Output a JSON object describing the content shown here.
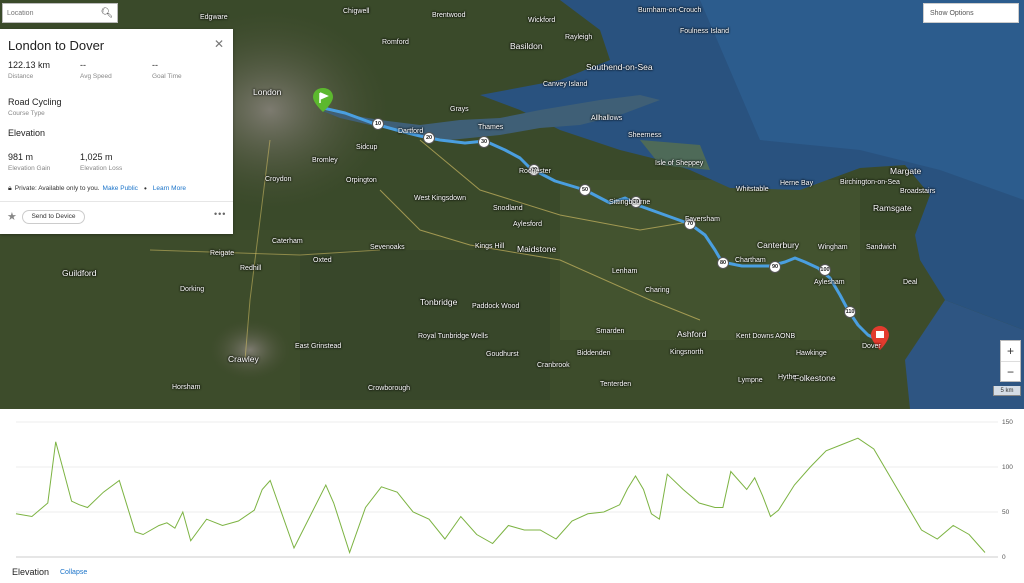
{
  "search": {
    "placeholder": "Location"
  },
  "options": {
    "label": "Show Options"
  },
  "panel": {
    "title": "London to Dover",
    "stats": [
      {
        "value": "122.13 km",
        "label": "Distance"
      },
      {
        "value": "--",
        "label": "Avg Speed"
      },
      {
        "value": "--",
        "label": "Goal Time"
      }
    ],
    "course_type": {
      "value": "Road Cycling",
      "label": "Course Type"
    },
    "elevation_heading": "Elevation",
    "elev_stats": [
      {
        "value": "981 m",
        "label": "Elevation Gain"
      },
      {
        "value": "1,025 m",
        "label": "Elevation Loss"
      }
    ],
    "privacy_text": "Private: Available only to you.",
    "make_public": "Make Public",
    "learn_more": "Learn More",
    "send_label": "Send to Device",
    "more_label": "•••"
  },
  "zoom": {
    "in": "+",
    "out": "−"
  },
  "scale": "5 km",
  "markers": [
    "10",
    "20",
    "30",
    "40",
    "50",
    "60",
    "70",
    "80",
    "90",
    "100",
    "110"
  ],
  "places": [
    "Edgware",
    "Romford",
    "Brentwood",
    "Basildon",
    "Wickford",
    "Southend-on-Sea",
    "Canvey Island",
    "London",
    "Grays",
    "Dartford",
    "Thames",
    "Bromley",
    "Sidcup",
    "Croydon",
    "Orpington",
    "West Kingsdown",
    "Snodland",
    "Aylesford",
    "Maidstone",
    "Kings Hill",
    "Sevenoaks",
    "Oxted",
    "Caterham",
    "Redhill",
    "Guildford",
    "Tonbridge",
    "Royal Tunbridge Wells",
    "East Grinstead",
    "Crawley",
    "Horsham",
    "Isle of Sheppey",
    "Sheerness",
    "Allhallows",
    "Whitstable",
    "Herne Bay",
    "Margate",
    "Ramsgate",
    "Canterbury",
    "Wingham",
    "Sandwich",
    "Deal",
    "Aylesham",
    "Chartham",
    "Faversham",
    "Sittingbourne",
    "Rochester",
    "Ashford",
    "Lenham",
    "Charing",
    "Hawkinge",
    "Folkestone",
    "Dover",
    "Broadstairs",
    "Birchington-on-Sea",
    "Foulness Island",
    "Burnham-on-Crouch",
    "Rayleigh",
    "Chigwell",
    "Cranbrook",
    "Biddenden",
    "Tenterden",
    "Goudhurst",
    "Crowborough",
    "Paddock Wood",
    "Smarden",
    "Kingsnorth",
    "Lympne",
    "Hythe",
    "Kent Downs AONB",
    "Dorking",
    "Reigate"
  ],
  "elevation": {
    "title": "Elevation",
    "collapse": "Collapse",
    "color": "#7cb342"
  },
  "route_color": "#4a9fe0",
  "chart_data": {
    "type": "area",
    "ylim": [
      0,
      150
    ],
    "yticks": [
      "150",
      "100",
      "50",
      "0"
    ],
    "x": [
      0,
      2,
      4,
      5,
      6,
      7,
      8,
      9,
      11,
      13,
      15,
      16,
      18,
      19,
      20,
      21,
      22,
      24,
      26,
      28,
      30,
      31,
      32,
      33,
      35,
      37,
      39,
      40,
      42,
      44,
      46,
      48,
      50,
      52,
      54,
      56,
      58,
      60,
      62,
      64,
      66,
      68,
      70,
      72,
      74,
      76,
      77,
      78,
      79,
      80,
      81,
      82,
      84,
      86,
      88,
      89,
      90,
      92,
      93,
      94,
      95,
      96,
      98,
      100,
      102,
      104,
      106,
      108,
      110,
      112,
      114,
      116,
      118,
      120,
      122
    ],
    "values": [
      48,
      45,
      60,
      128,
      95,
      62,
      58,
      55,
      72,
      85,
      28,
      25,
      35,
      38,
      32,
      50,
      18,
      42,
      35,
      40,
      52,
      75,
      85,
      60,
      10,
      45,
      80,
      60,
      5,
      55,
      78,
      72,
      50,
      42,
      20,
      45,
      25,
      15,
      35,
      30,
      30,
      20,
      40,
      48,
      50,
      58,
      76,
      90,
      75,
      48,
      42,
      92,
      75,
      60,
      55,
      55,
      95,
      75,
      88,
      68,
      45,
      52,
      80,
      100,
      118,
      125,
      132,
      120,
      90,
      60,
      30,
      20,
      35,
      25,
      5
    ]
  }
}
